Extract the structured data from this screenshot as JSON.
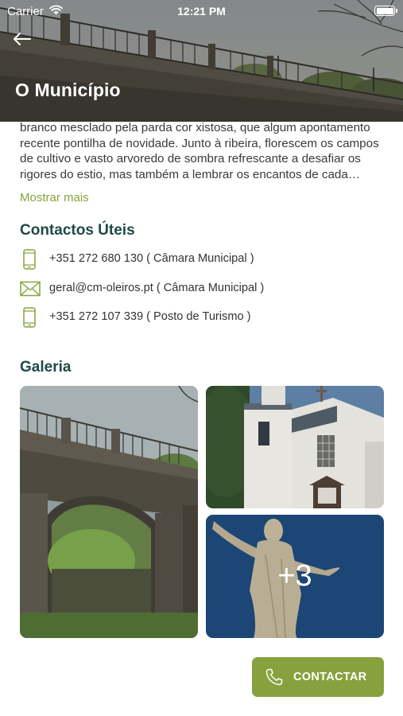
{
  "status_bar": {
    "carrier": "Carrier",
    "time": "12:21 PM"
  },
  "header": {
    "title": "O Município"
  },
  "description": {
    "text": "branco mesclado pela parda cor xistosa, que algum apontamento recente pontilha de novidade. Junto à ribeira, florescem os campos de cultivo e vasto arvoredo de sombra refrescante a desafiar os rigores do estio, mas também a lembrar os encantos de cada estação do ano.",
    "show_more": "Mostrar mais"
  },
  "contacts": {
    "title": "Contactos Úteis",
    "items": [
      {
        "icon": "mobile-phone-icon",
        "text": "+351 272 680 130 ( Câmara Municipal )"
      },
      {
        "icon": "envelope-icon",
        "text": "geral@cm-oleiros.pt ( Câmara Municipal )"
      },
      {
        "icon": "mobile-phone-icon",
        "text": "+351 272 107 339 ( Posto de Turismo )"
      }
    ]
  },
  "gallery": {
    "title": "Galeria",
    "more_label": "+3"
  },
  "contact_button": {
    "label": "CONTACTAR",
    "icon": "phone-icon"
  },
  "colors": {
    "accent": "#87a23c",
    "heading": "#1e4a45",
    "link": "#8aa23e"
  }
}
